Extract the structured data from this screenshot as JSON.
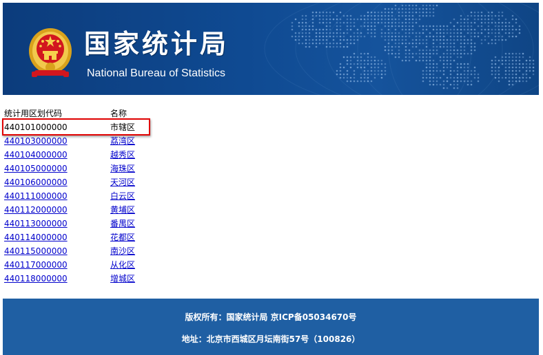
{
  "header": {
    "title_cn": "国家统计局",
    "title_en": "National Bureau of Statistics",
    "background_color": "#0f4a92"
  },
  "table": {
    "columns": [
      "统计用区划代码",
      "名称"
    ],
    "rows": [
      {
        "code": "440101000000",
        "name": "市辖区",
        "linked": false,
        "highlighted": true
      },
      {
        "code": "440103000000",
        "name": "荔湾区",
        "linked": true
      },
      {
        "code": "440104000000",
        "name": "越秀区",
        "linked": true
      },
      {
        "code": "440105000000",
        "name": "海珠区",
        "linked": true
      },
      {
        "code": "440106000000",
        "name": "天河区",
        "linked": true
      },
      {
        "code": "440111000000",
        "name": "白云区",
        "linked": true
      },
      {
        "code": "440112000000",
        "name": "黄埔区",
        "linked": true
      },
      {
        "code": "440113000000",
        "name": "番禺区",
        "linked": true
      },
      {
        "code": "440114000000",
        "name": "花都区",
        "linked": true
      },
      {
        "code": "440115000000",
        "name": "南沙区",
        "linked": true
      },
      {
        "code": "440117000000",
        "name": "从化区",
        "linked": true
      },
      {
        "code": "440118000000",
        "name": "增城区",
        "linked": true
      }
    ],
    "link_color": "#0000cc",
    "highlight_color": "#e00000"
  },
  "footer": {
    "copyright": "版权所有：国家统计局 京ICP备05034670号",
    "address": "地址：北京市西城区月坛南街57号（100826）",
    "background_color": "#1f5fa3"
  },
  "icons": {
    "emblem": "national-emblem-icon",
    "background": "world-map-dots"
  }
}
